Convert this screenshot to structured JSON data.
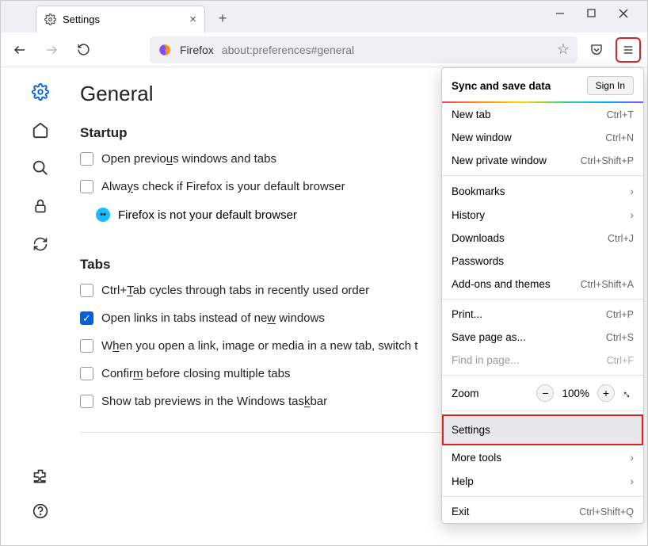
{
  "tab": {
    "title": "Settings"
  },
  "urlbar": {
    "browser": "Firefox",
    "url": "about:preferences#general"
  },
  "page": {
    "title": "General",
    "startup": {
      "heading": "Startup",
      "opt_previous": "Open previous windows and tabs",
      "opt_default": "Always check if Firefox is your default browser",
      "status": "Firefox is not your default browser"
    },
    "tabs": {
      "heading": "Tabs",
      "opt_cycle": "Ctrl+Tab cycles through tabs in recently used order",
      "opt_openlinks": "Open links in tabs instead of new windows",
      "opt_switch": "When you open a link, image or media in a new tab, switch t",
      "opt_confirm": "Confirm before closing multiple tabs",
      "opt_preview": "Show tab previews in the Windows taskbar"
    }
  },
  "menu": {
    "sync_title": "Sync and save data",
    "signin": "Sign In",
    "items": [
      {
        "label": "New tab",
        "shortcut": "Ctrl+T"
      },
      {
        "label": "New window",
        "shortcut": "Ctrl+N"
      },
      {
        "label": "New private window",
        "shortcut": "Ctrl+Shift+P"
      }
    ],
    "items2": [
      {
        "label": "Bookmarks",
        "chev": true
      },
      {
        "label": "History",
        "chev": true
      },
      {
        "label": "Downloads",
        "shortcut": "Ctrl+J"
      },
      {
        "label": "Passwords"
      },
      {
        "label": "Add-ons and themes",
        "shortcut": "Ctrl+Shift+A"
      }
    ],
    "items3": [
      {
        "label": "Print...",
        "shortcut": "Ctrl+P"
      },
      {
        "label": "Save page as...",
        "shortcut": "Ctrl+S"
      },
      {
        "label": "Find in page...",
        "shortcut": "Ctrl+F",
        "disabled": true
      }
    ],
    "zoom": {
      "label": "Zoom",
      "value": "100%"
    },
    "settings": "Settings",
    "items4": [
      {
        "label": "More tools",
        "chev": true
      },
      {
        "label": "Help",
        "chev": true
      }
    ],
    "exit": {
      "label": "Exit",
      "shortcut": "Ctrl+Shift+Q"
    }
  }
}
